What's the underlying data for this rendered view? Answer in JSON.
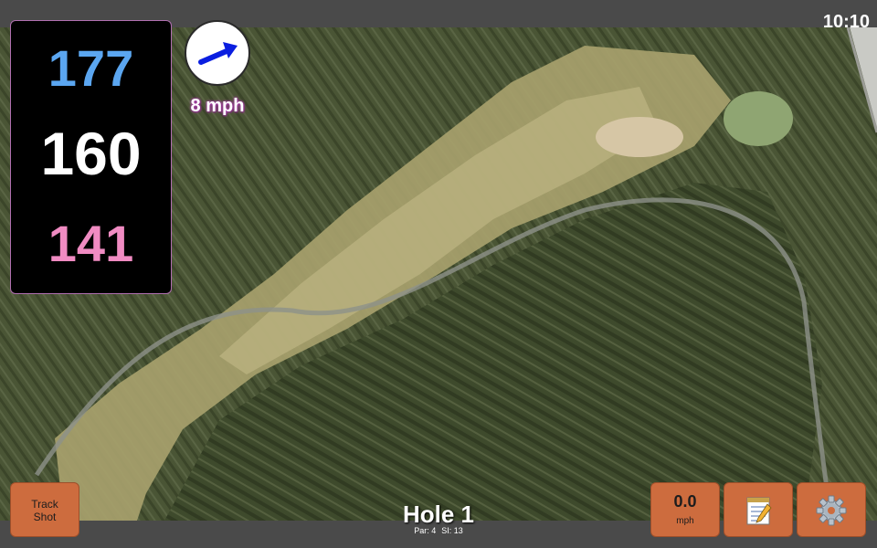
{
  "status": {
    "time": "10:10"
  },
  "distances": {
    "back": "177",
    "center": "160",
    "front": "141"
  },
  "wind": {
    "speed": "8 mph",
    "direction_icon": "wind-arrow-icon"
  },
  "hole": {
    "title": "Hole 1",
    "par": "Par: 4",
    "stroke_index": "SI: 13"
  },
  "buttons": {
    "track_line1": "Track",
    "track_line2": "Shot",
    "speed_value": "0.0",
    "speed_unit": "mph",
    "scorecard_icon": "notepad-icon",
    "settings_icon": "gear-icon"
  },
  "colors": {
    "back": "#5ba6f0",
    "center": "#ffffff",
    "front": "#f08bc2",
    "button": "#cd6c3e",
    "wind_arrow": "#0a1ee0"
  }
}
